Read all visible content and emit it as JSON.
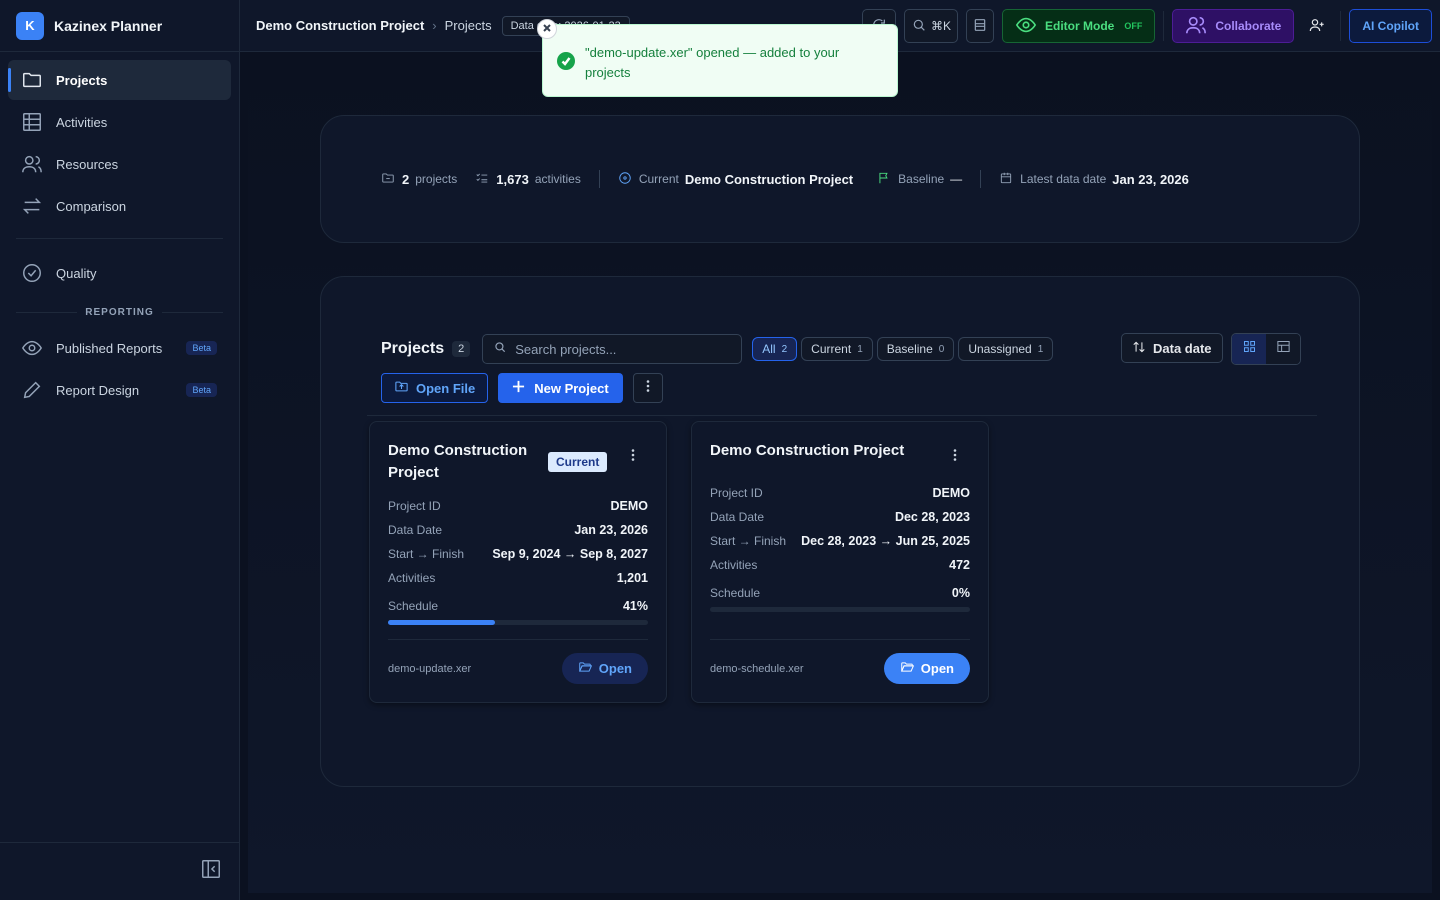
{
  "app": {
    "logo_letter": "K",
    "name": "Kazinex Planner"
  },
  "sidebar": {
    "items": [
      {
        "label": "Projects",
        "icon": "folder-icon",
        "active": true
      },
      {
        "label": "Activities",
        "icon": "table-icon"
      },
      {
        "label": "Resources",
        "icon": "users-icon"
      },
      {
        "label": "Comparison",
        "icon": "arrows-swap-icon"
      }
    ],
    "quality_label": "Quality",
    "reporting_label": "REPORTING",
    "reporting_items": [
      {
        "label": "Published Reports",
        "badge": "Beta",
        "icon": "eye-icon"
      },
      {
        "label": "Report Design",
        "badge": "Beta",
        "icon": "pencil-icon"
      }
    ]
  },
  "header": {
    "breadcrumb_main": "Demo Construction Project",
    "breadcrumb_sub": "Projects",
    "data_chip": "Data date: 2026-01-23",
    "search_shortcut": "⌘K",
    "editor_mode_label": "Editor Mode",
    "editor_mode_state": "OFF",
    "collaborate_label": "Collaborate",
    "ai_label": "AI Copilot"
  },
  "toast": {
    "message": "\"demo-update.xer\" opened — added to your projects"
  },
  "stats": {
    "projects_count": "2",
    "projects_label": "projects",
    "activities_count": "1,673",
    "activities_label": "activities",
    "current_label": "Current",
    "current_value": "Demo Construction Project",
    "baseline_label": "Baseline",
    "baseline_value": "—",
    "latest_label": "Latest data date",
    "latest_value": "Jan 23, 2026"
  },
  "projects": {
    "title": "Projects",
    "count": "2",
    "search_placeholder": "Search projects...",
    "filters": [
      {
        "label": "All",
        "count": "2",
        "active": true
      },
      {
        "label": "Current",
        "count": "1"
      },
      {
        "label": "Baseline",
        "count": "0"
      },
      {
        "label": "Unassigned",
        "count": "1"
      }
    ],
    "sort_label": "Data date",
    "open_file_label": "Open File",
    "new_project_label": "New Project",
    "cards": [
      {
        "title": "Demo Construction Project",
        "badge": "Current",
        "project_id_label": "Project ID",
        "project_id": "DEMO",
        "data_date_label": "Data Date",
        "data_date": "Jan 23, 2026",
        "start_finish_label": "Start → Finish",
        "start_finish": "Sep 9, 2024 → Sep 8, 2027",
        "activities_label": "Activities",
        "activities": "1,201",
        "schedule_label": "Schedule",
        "schedule": "41%",
        "schedule_fraction": 0.41,
        "file": "demo-update.xer",
        "open_label": "Open"
      },
      {
        "title": "Demo Construction Project",
        "project_id_label": "Project ID",
        "project_id": "DEMO",
        "data_date_label": "Data Date",
        "data_date": "Dec 28, 2023",
        "start_finish_label": "Start → Finish",
        "start_finish": "Dec 28, 2023 → Jun 25, 2025",
        "activities_label": "Activities",
        "activities": "472",
        "schedule_label": "Schedule",
        "schedule": "0%",
        "schedule_fraction": 0,
        "file": "demo-schedule.xer",
        "open_label": "Open"
      }
    ]
  }
}
